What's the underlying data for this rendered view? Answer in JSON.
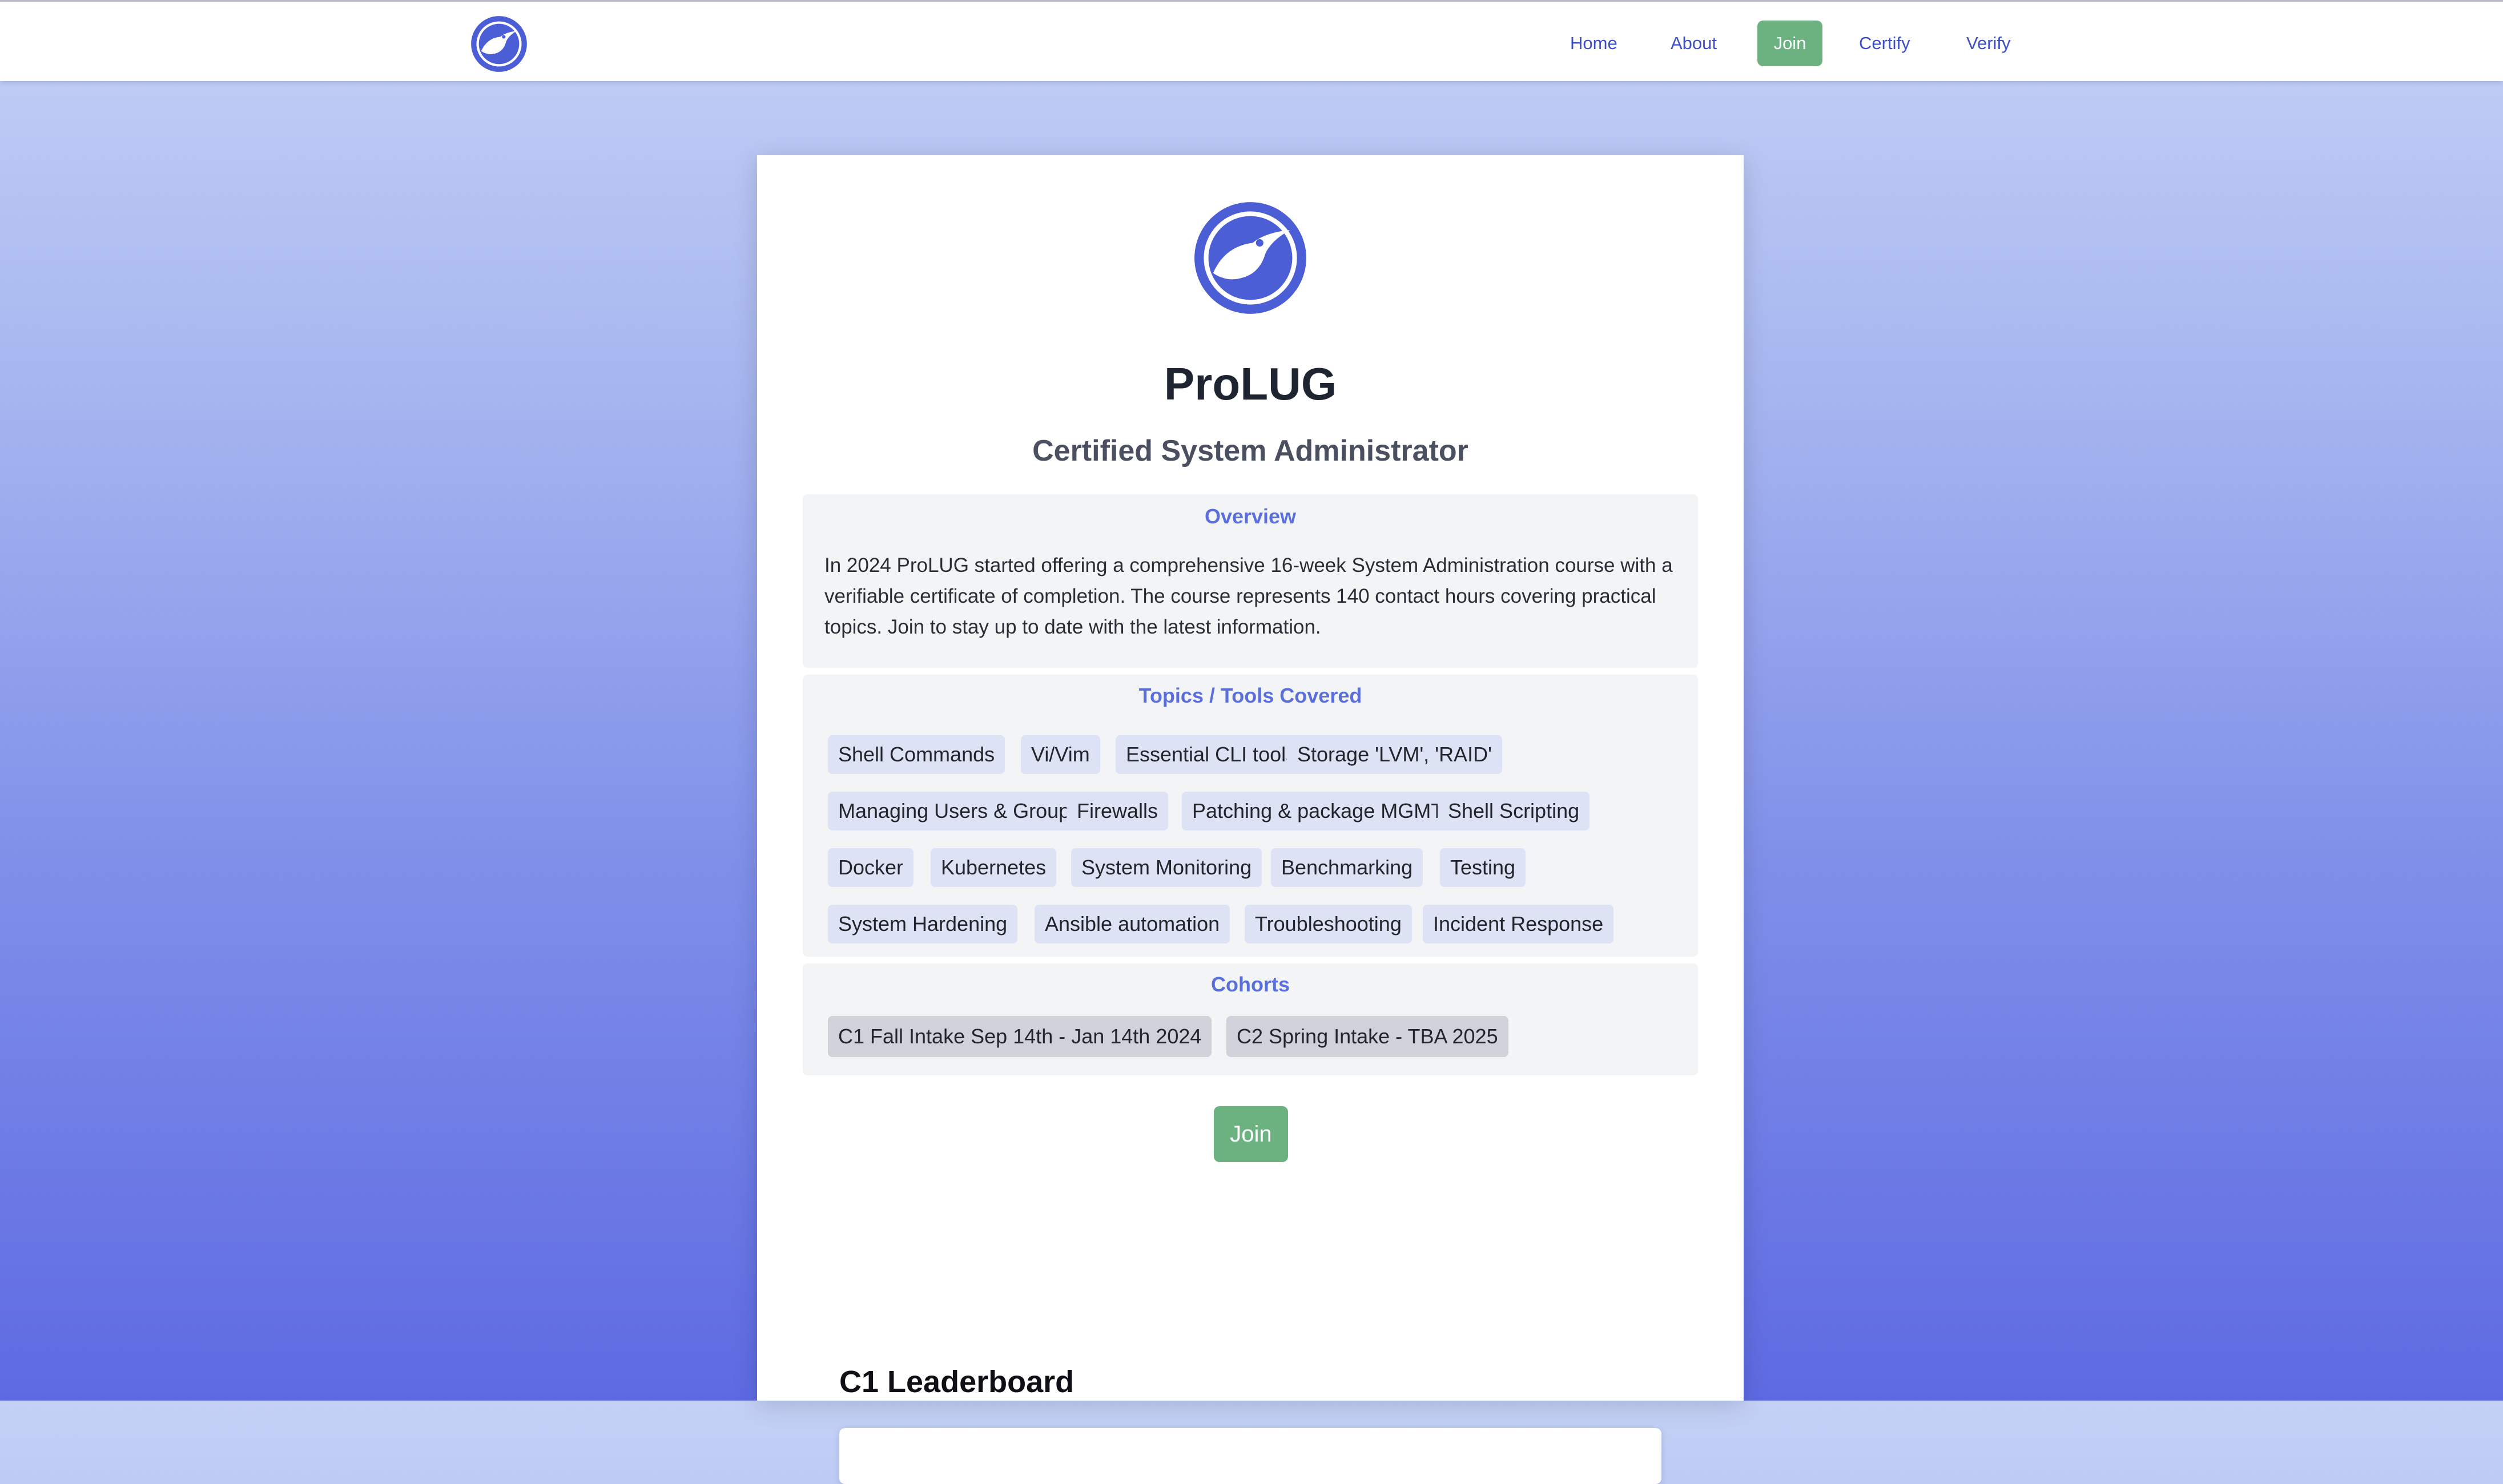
{
  "nav": {
    "logo_icon": "prolug-bird-logo-icon",
    "links": [
      "Home",
      "About",
      "Join",
      "Certify",
      "Verify"
    ],
    "active": "Join"
  },
  "hero": {
    "logo_icon": "prolug-bird-logo-icon",
    "title": "ProLUG",
    "subtitle": "Certified System Administrator"
  },
  "overview": {
    "heading": "Overview",
    "text": "In 2024 ProLUG started offering a comprehensive 16-week System Administration course with a verifiable certificate of completion. The course represents 140 contact hours covering practical topics. Join to stay up to date with the latest information."
  },
  "topics": {
    "heading": "Topics / Tools Covered",
    "items": [
      "Shell Commands",
      "Vi/Vim",
      "Essential CLI tools",
      "Storage 'LVM', 'RAID'",
      "Managing Users & Groups",
      "Firewalls",
      "Patching & package MGMT",
      "Shell Scripting",
      "Docker",
      "Kubernetes",
      "System Monitoring",
      "Benchmarking",
      "Testing",
      "System Hardening",
      "Ansible automation",
      "Troubleshooting",
      "Incident Response"
    ]
  },
  "cohorts": {
    "heading": "Cohorts",
    "items": [
      "C1 Fall Intake Sep 14th - Jan 14th 2024",
      "C2 Spring Intake - TBA 2025"
    ]
  },
  "join_button": "Join",
  "leaderboard": {
    "title": "C1 Leaderboard"
  },
  "colors": {
    "accent": "#3c4fc9",
    "join_green": "#6cb280",
    "heading_blue": "#5b6fdc",
    "tag_bg": "#dde2f4",
    "cohort_bg": "#cfd2d8"
  }
}
